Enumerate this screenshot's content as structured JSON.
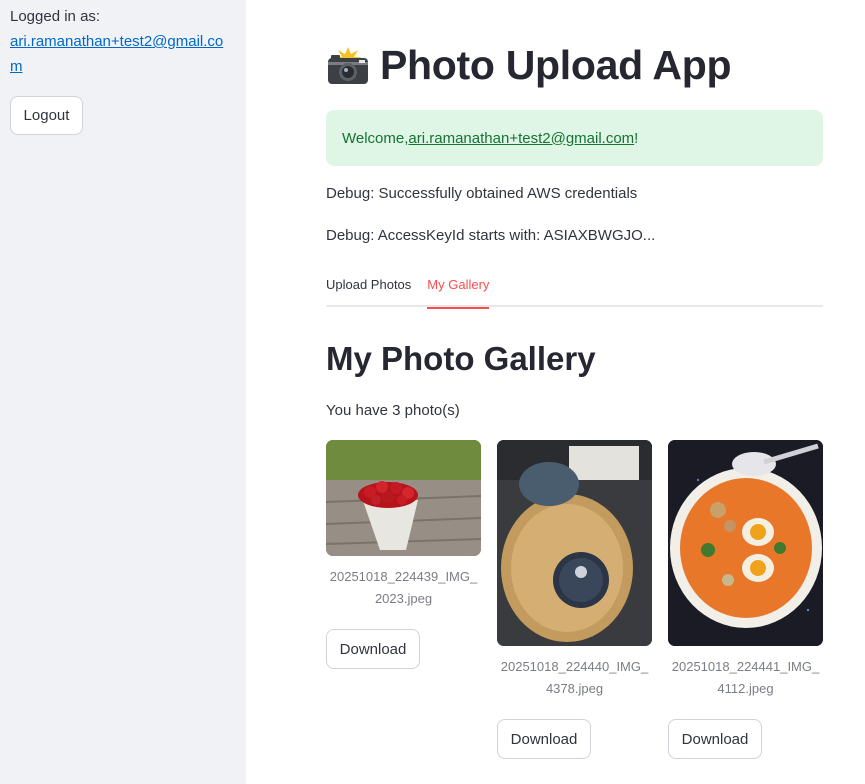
{
  "sidebar": {
    "logged_label": "Logged in as:",
    "email": "ari.ramanathan+test2@gmail.com",
    "logout_label": "Logout"
  },
  "header": {
    "icon": "camera-flash-icon",
    "title": "Photo Upload App"
  },
  "welcome": {
    "prefix": "Welcome, ",
    "email": "ari.ramanathan+test2@gmail.com",
    "suffix": "!"
  },
  "debug": {
    "line1": "Debug: Successfully obtained AWS credentials",
    "line2": "Debug: AccessKeyId starts with: ASIAXBWGJO..."
  },
  "tabs": [
    {
      "label": "Upload Photos",
      "active": false
    },
    {
      "label": "My Gallery",
      "active": true
    }
  ],
  "gallery": {
    "title": "My Photo Gallery",
    "count_text": "You have 3 photo(s)",
    "photos": [
      {
        "filename": "20251018_224439_IMG_2023.jpeg",
        "subject": "strawberries-photo",
        "download_label": "Download"
      },
      {
        "filename": "20251018_224440_IMG_4378.jpeg",
        "subject": "pie-photo",
        "download_label": "Download"
      },
      {
        "filename": "20251018_224441_IMG_4112.jpeg",
        "subject": "noodle-soup-photo",
        "download_label": "Download"
      }
    ]
  },
  "colors": {
    "sidebar_bg": "#f0f2f6",
    "link": "#0068c9",
    "success_bg": "#dff6e6",
    "success_text": "#177233",
    "active_tab": "#ff4b4b"
  }
}
